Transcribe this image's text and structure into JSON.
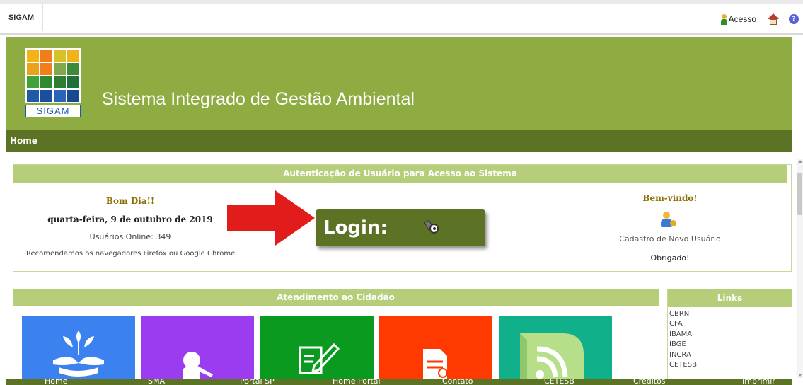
{
  "topbar": {
    "app_tab": "SIGAM",
    "access_label": "Acesso",
    "user_icon": "user-icon",
    "home_icon": "home-icon",
    "help_icon": "help-icon"
  },
  "banner": {
    "logo_text": "SIGAM",
    "title": "Sistema Integrado de Gestão Ambiental"
  },
  "nav": {
    "home": "Home"
  },
  "auth": {
    "header": "Autenticação de Usuário para Acesso ao Sistema",
    "greeting": "Bom Dia!!",
    "date": "quarta-feira, 9 de outubro de 2019",
    "online": "Usuários Online: 349",
    "browsers": "Recomendamos os navegadores Firefox ou Google Chrome.",
    "login_label": "Login:",
    "welcome": "Bem-vindo!",
    "new_user": "Cadastro de Novo Usuário",
    "thanks": "Obrigado!"
  },
  "citizen": {
    "header": "Atendimento ao Cidadão",
    "tiles": [
      {
        "icon": "hands-plant-icon",
        "color": "#3b82f0"
      },
      {
        "icon": "person-icon",
        "color": "#9b3cf0"
      },
      {
        "icon": "form-pencil-icon",
        "color": "#0a9a1f"
      },
      {
        "icon": "document-icon",
        "color": "#ff3a00"
      },
      {
        "icon": "rss-icon",
        "color": "#10b08a"
      }
    ]
  },
  "links": {
    "header": "Links",
    "items": [
      "CBRN",
      "CFA",
      "IBAMA",
      "IBGE",
      "INCRA",
      "CETESB"
    ]
  },
  "footer": {
    "items": [
      "Home",
      "SMA",
      "Portal SP",
      "Home Portal",
      "Contato",
      "CETESB",
      "Créditos",
      "Imprimir"
    ]
  },
  "colors": {
    "banner": "#8fac42",
    "nav": "#5c7224",
    "section_header": "#b6cd79",
    "arrow": "#e21b1b"
  }
}
